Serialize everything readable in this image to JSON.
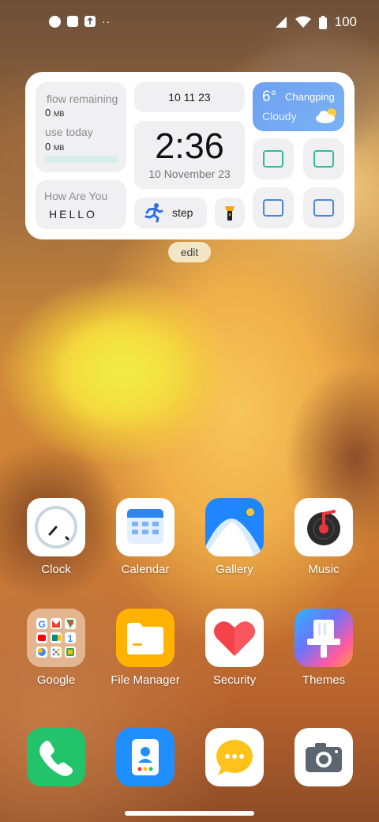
{
  "status": {
    "battery": "100",
    "more": "··"
  },
  "widget": {
    "flow_label": "flow remaining",
    "flow_value": "0",
    "flow_unit": "MB",
    "use_label": "use today",
    "use_value": "0",
    "use_unit": "MB",
    "greeting_label": "How Are You",
    "greeting_text": "HELLO",
    "date_top": "10 11 23",
    "time": "2:36",
    "date_bottom": "10 November 23",
    "step_label": "step",
    "weather_temp": "6°",
    "weather_city": "Changping",
    "weather_cond": "Cloudy"
  },
  "edit_label": "edit",
  "apps_row1": [
    "Clock",
    "Calendar",
    "Gallery",
    "Music"
  ],
  "apps_row2": [
    "Google",
    "File Manager",
    "Security",
    "Themes"
  ],
  "dock": [
    "phone-icon",
    "contacts-icon",
    "messages-icon",
    "camera-icon"
  ],
  "colors": {
    "weather": "#6fa6f2",
    "phone": "#22c36b",
    "contacts": "#1f8fff",
    "messages": "#ffc21a",
    "filemgr": "#ffb300",
    "music_red": "#e8363c"
  }
}
